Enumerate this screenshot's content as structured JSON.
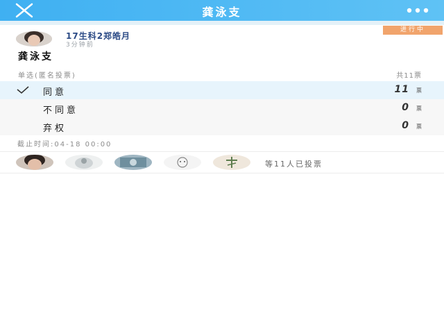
{
  "header": {
    "title": "龚泳支",
    "close_icon": "close-icon",
    "more_icon": "more-icon",
    "background": "#3fb0f2"
  },
  "post": {
    "author": "17生科2郑皓月",
    "time_ago": "3分钟前",
    "status": "进行中",
    "status_color": "#f1a46c"
  },
  "vote": {
    "title": "龚泳支",
    "type": "单选(匿名投票)",
    "total": "共11票",
    "options": [
      {
        "label": "同意",
        "count": "11",
        "unit": "票",
        "selected": true
      },
      {
        "label": "不同意",
        "count": "0",
        "unit": "票",
        "selected": false
      },
      {
        "label": "弃权",
        "count": "0",
        "unit": "票",
        "selected": false
      }
    ],
    "deadline": "截止时间:04-18 00:00"
  },
  "voters": {
    "summary": "等11人已投票"
  }
}
